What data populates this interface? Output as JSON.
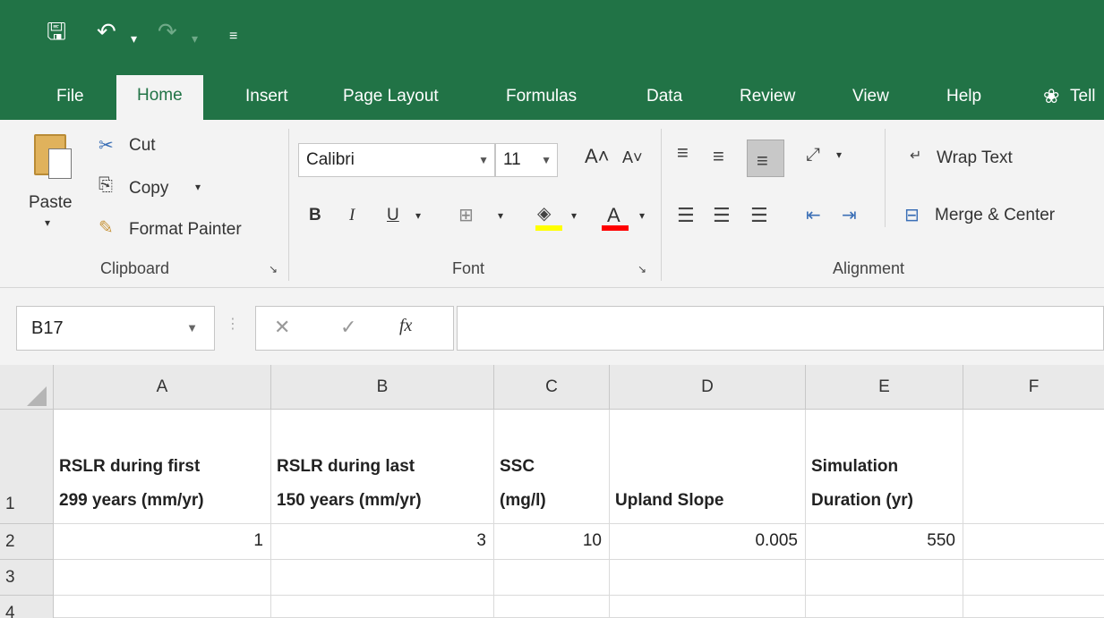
{
  "quick_access": {
    "undo_icon": "undo-icon",
    "redo_icon": "redo-icon"
  },
  "tabs": [
    "File",
    "Home",
    "Insert",
    "Page Layout",
    "Formulas",
    "Data",
    "Review",
    "View",
    "Help",
    "Tell"
  ],
  "clipboard": {
    "paste": "Paste",
    "cut": "Cut",
    "copy": "Copy",
    "format_painter": "Format Painter",
    "group_label": "Clipboard"
  },
  "font": {
    "family": "Calibri",
    "size": "11",
    "bold": "B",
    "italic": "I",
    "underline": "U",
    "group_label": "Font"
  },
  "alignment": {
    "wrap_text": "Wrap Text",
    "merge_center": "Merge & Center",
    "group_label": "Alignment"
  },
  "formula_bar": {
    "name_box": "B17",
    "fx": "fx",
    "formula": ""
  },
  "columns": [
    "A",
    "B",
    "C",
    "D",
    "E",
    "F"
  ],
  "rows": [
    "1",
    "2",
    "3",
    "4"
  ],
  "headers": {
    "a": [
      "RSLR during first",
      "299 years (mm/yr)"
    ],
    "b": [
      "RSLR during last",
      "150 years (mm/yr)"
    ],
    "c": [
      "SSC",
      "(mg/l)"
    ],
    "d": [
      "",
      "Upland Slope"
    ],
    "e": [
      "Simulation",
      "Duration (yr)"
    ]
  },
  "row2": {
    "a": "1",
    "b": "3",
    "c": "10",
    "d": "0.005",
    "e": "550"
  },
  "colors": {
    "accent": "#217346",
    "ribbon": "#f3f3f3",
    "highlight_yellow": "#ffff00",
    "font_red": "#ff0000"
  }
}
